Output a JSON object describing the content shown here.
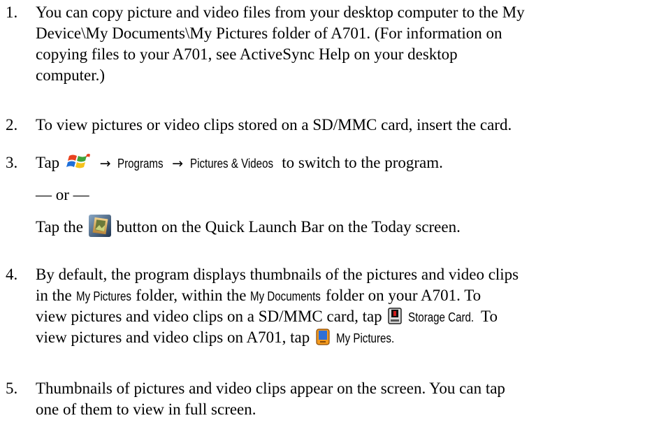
{
  "items": [
    {
      "number": "1.",
      "lines": [
        "You can copy picture and video files from your desktop computer to the My",
        "Device\\My Documents\\My Pictures folder of A701. (For information on",
        "copying files to your A701, see ActiveSync Help on your desktop",
        "computer.)"
      ]
    },
    {
      "number": "2.",
      "lines": [
        "To view pictures or video clips stored on a SD/MMC card, insert the card."
      ]
    },
    {
      "number": "3.",
      "tap": "Tap",
      "arrow": "→",
      "programs": "Programs",
      "pictures_videos": "Pictures & Videos",
      "to_switch": "to switch to the program.",
      "or": "— or —",
      "tap_the": "Tap the",
      "button_text": "button on the Quick Launch Bar on the Today screen."
    },
    {
      "number": "4.",
      "line1": "By default, the program displays thumbnails of the pictures and video clips",
      "line2_a": "in the",
      "my_pictures": "My Pictures",
      "line2_b": "folder, within the",
      "my_documents": "My Documents",
      "line2_c": "folder on your A701. To",
      "line3_a": "view pictures and video clips on a SD/MMC card, tap",
      "storage_card": "Storage Card.",
      "line3_b": "To",
      "line4_a": "view pictures and video clips on A701, tap",
      "my_pictures_2": "My Pictures."
    },
    {
      "number": "5.",
      "lines": [
        "Thumbnails of pictures and video clips appear on the screen. You can tap",
        "one of them to view in full screen."
      ]
    }
  ],
  "icons": {
    "start": "windows-start-icon",
    "pictures_button": "pictures-videos-button-icon",
    "storage_card": "storage-card-icon",
    "device": "device-icon"
  }
}
